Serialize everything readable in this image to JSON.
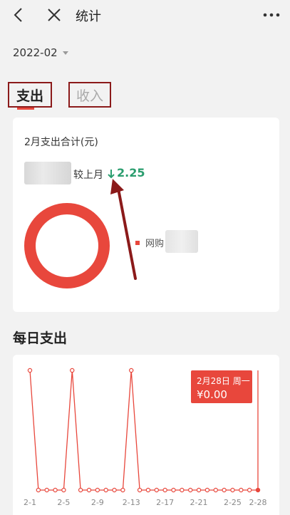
{
  "header": {
    "title": "统计"
  },
  "date_selector": {
    "value": "2022-02"
  },
  "tabs": [
    {
      "label": "支出",
      "active": true
    },
    {
      "label": "收入",
      "active": false
    }
  ],
  "summary": {
    "title": "2月支出合计(元)",
    "compare_label": "较上月",
    "compare_value": "2.25",
    "legend": [
      {
        "label": "网购"
      }
    ]
  },
  "daily": {
    "title": "每日支出",
    "tooltip": {
      "date": "2月28日 周一",
      "value": "¥0.00"
    }
  },
  "colors": {
    "accent": "#e8473c",
    "decrease": "#2a9d6e",
    "annotation": "#8b1a1a"
  },
  "chart_data": {
    "type": "line",
    "x": [
      "2-1",
      "2-2",
      "2-3",
      "2-4",
      "2-5",
      "2-6",
      "2-7",
      "2-8",
      "2-9",
      "2-10",
      "2-11",
      "2-12",
      "2-13",
      "2-14",
      "2-15",
      "2-16",
      "2-17",
      "2-18",
      "2-19",
      "2-20",
      "2-21",
      "2-22",
      "2-23",
      "2-24",
      "2-25",
      "2-26",
      "2-27",
      "2-28"
    ],
    "values": [
      1,
      0,
      0,
      0,
      0,
      1,
      0,
      0,
      0,
      0,
      0,
      0,
      1,
      0,
      0,
      0,
      0,
      0,
      0,
      0,
      0,
      0,
      0,
      0,
      0,
      0,
      0,
      0
    ],
    "tick_labels": [
      "2-1",
      "2-5",
      "2-9",
      "2-13",
      "2-17",
      "2-21",
      "2-25",
      "2-28"
    ],
    "highlight_index": 27,
    "ylim": [
      0,
      1
    ]
  }
}
